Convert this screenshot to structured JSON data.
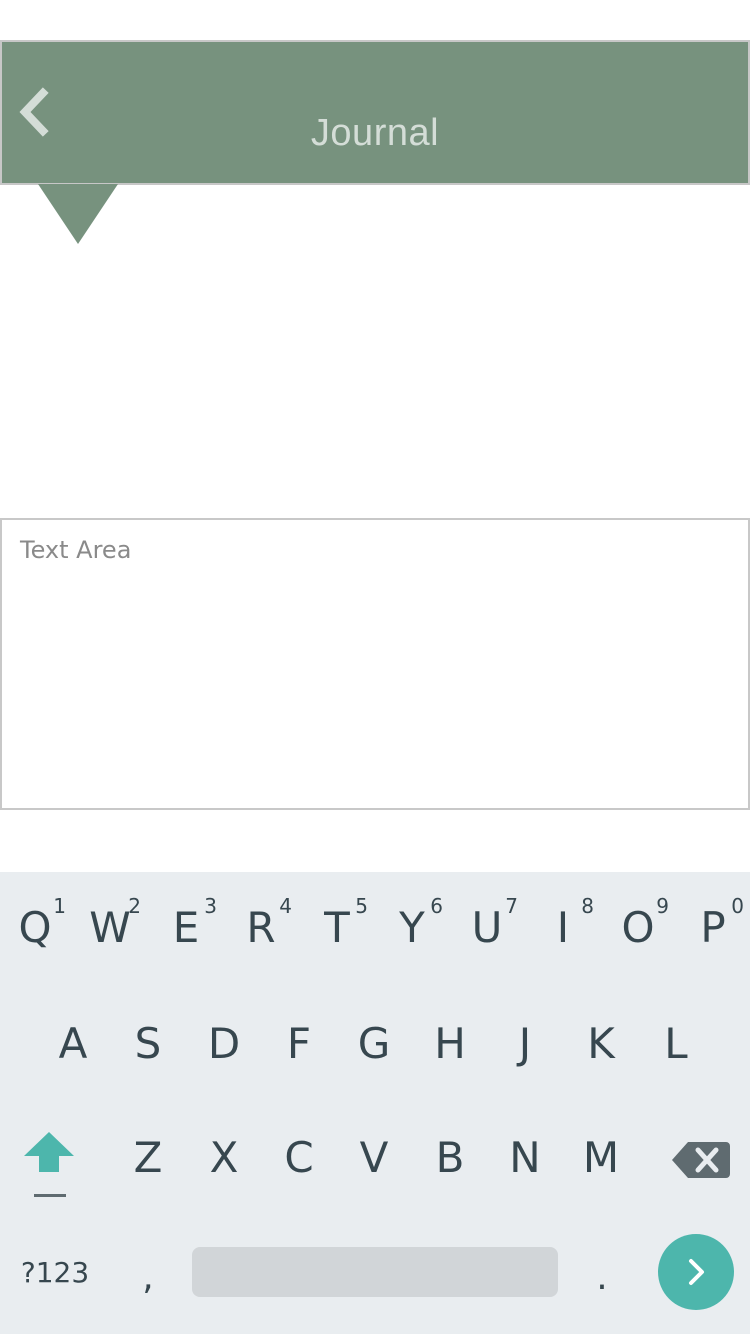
{
  "header": {
    "title": "Journal",
    "background_color": "#77927e",
    "back_icon": "chevron-left-icon"
  },
  "editor": {
    "placeholder": "Text Area",
    "value": ""
  },
  "keyboard": {
    "rows": [
      [
        {
          "label": "Q",
          "hint": "1"
        },
        {
          "label": "W",
          "hint": "2"
        },
        {
          "label": "E",
          "hint": "3"
        },
        {
          "label": "R",
          "hint": "4"
        },
        {
          "label": "T",
          "hint": "5"
        },
        {
          "label": "Y",
          "hint": "6"
        },
        {
          "label": "U",
          "hint": "7"
        },
        {
          "label": "I",
          "hint": "8"
        },
        {
          "label": "O",
          "hint": "9"
        },
        {
          "label": "P",
          "hint": "0"
        }
      ],
      [
        {
          "label": "A"
        },
        {
          "label": "S"
        },
        {
          "label": "D"
        },
        {
          "label": "F"
        },
        {
          "label": "G"
        },
        {
          "label": "H"
        },
        {
          "label": "J"
        },
        {
          "label": "K"
        },
        {
          "label": "L"
        }
      ],
      [
        {
          "label": "Z"
        },
        {
          "label": "X"
        },
        {
          "label": "C"
        },
        {
          "label": "V"
        },
        {
          "label": "B"
        },
        {
          "label": "N"
        },
        {
          "label": "M"
        }
      ]
    ],
    "symbols_label": "?123",
    "comma_label": ",",
    "period_label": ".",
    "shift_icon": "shift-arrow-icon",
    "backspace_icon": "backspace-icon",
    "go_icon": "chevron-right-icon",
    "accent_color": "#4db6ac",
    "background_color": "#e9edf0"
  }
}
